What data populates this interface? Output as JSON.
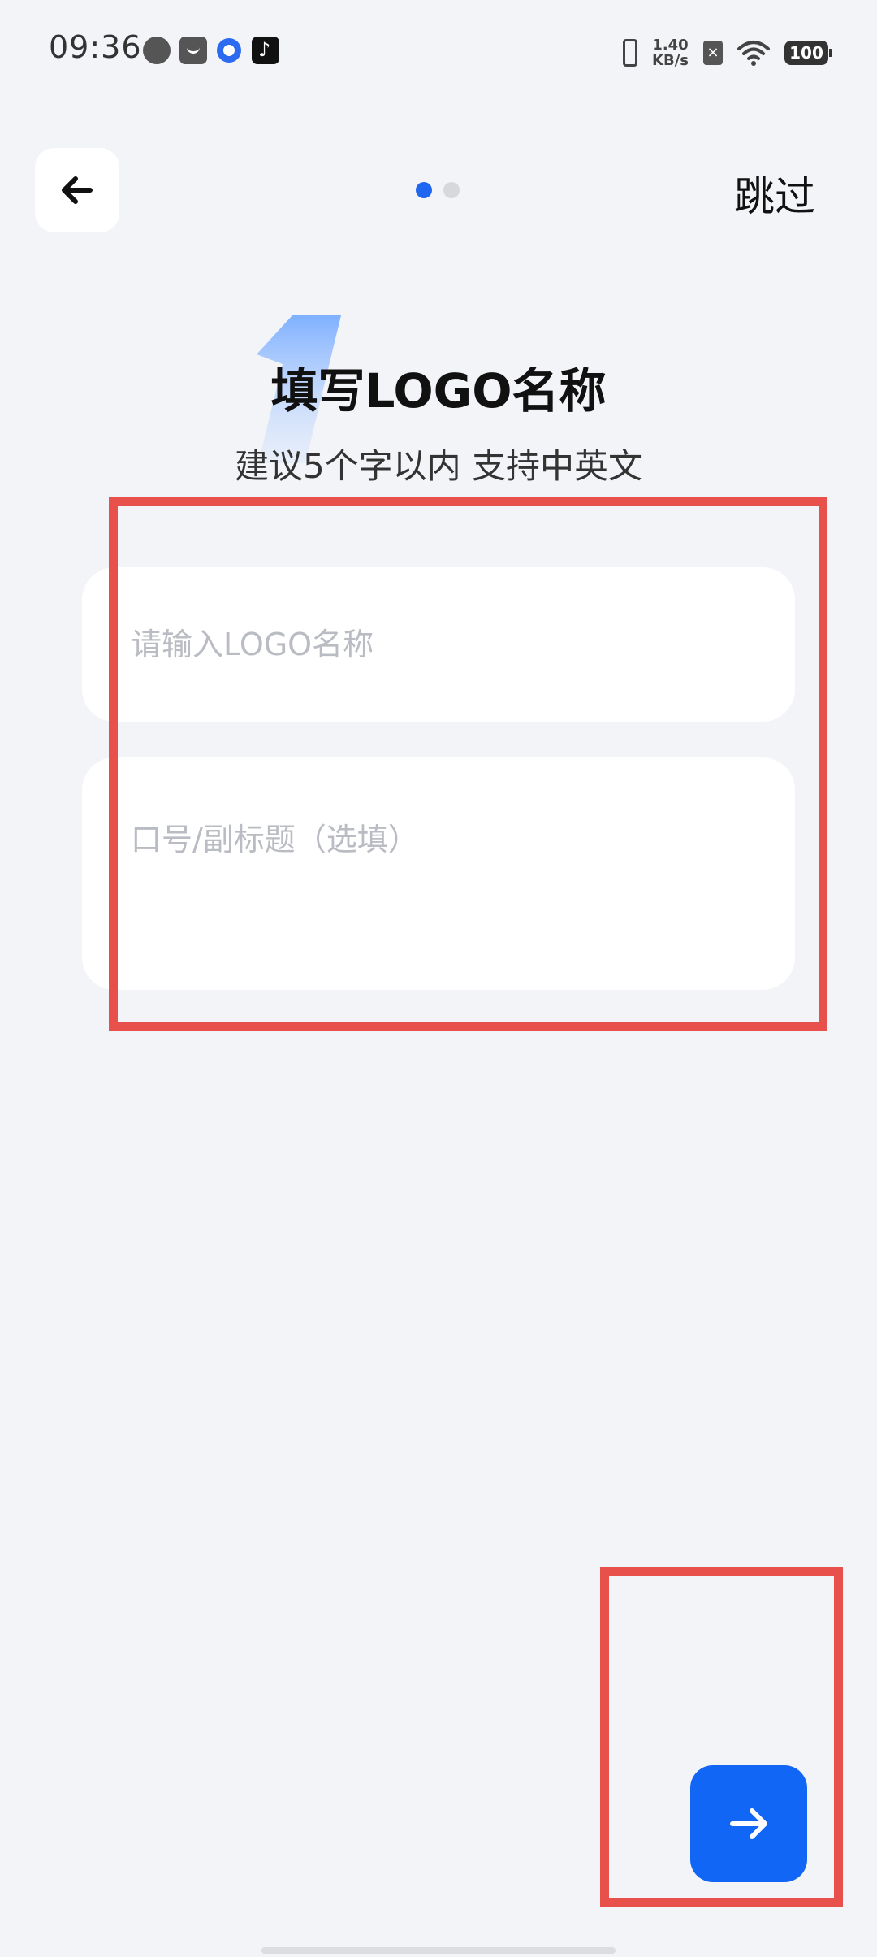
{
  "status_bar": {
    "time": "09:36",
    "net_speed_value": "1.40",
    "net_speed_unit": "KB/s",
    "battery": "100",
    "icons": [
      "feather-app-icon",
      "shopping-bag-icon",
      "browser-app-icon",
      "tiktok-icon",
      "vibrate-icon",
      "no-sim-icon",
      "wifi-icon",
      "battery-icon"
    ]
  },
  "header": {
    "back_icon": "arrow-left-icon",
    "skip_label": "跳过",
    "page_indicator": {
      "total": 2,
      "active": 1
    }
  },
  "step": {
    "title": "填写LOGO名称",
    "subtitle": "建议5个字以内  支持中英文"
  },
  "form": {
    "name_placeholder": "请输入LOGO名称",
    "name_value": "",
    "slogan_placeholder": "口号/副标题（选填）",
    "slogan_value": ""
  },
  "footer": {
    "next_icon": "arrow-right-icon"
  },
  "colors": {
    "background": "#f3f4f7",
    "accent": "#1266f5",
    "highlight": "#e8504b",
    "placeholder": "#b9bcc2"
  }
}
